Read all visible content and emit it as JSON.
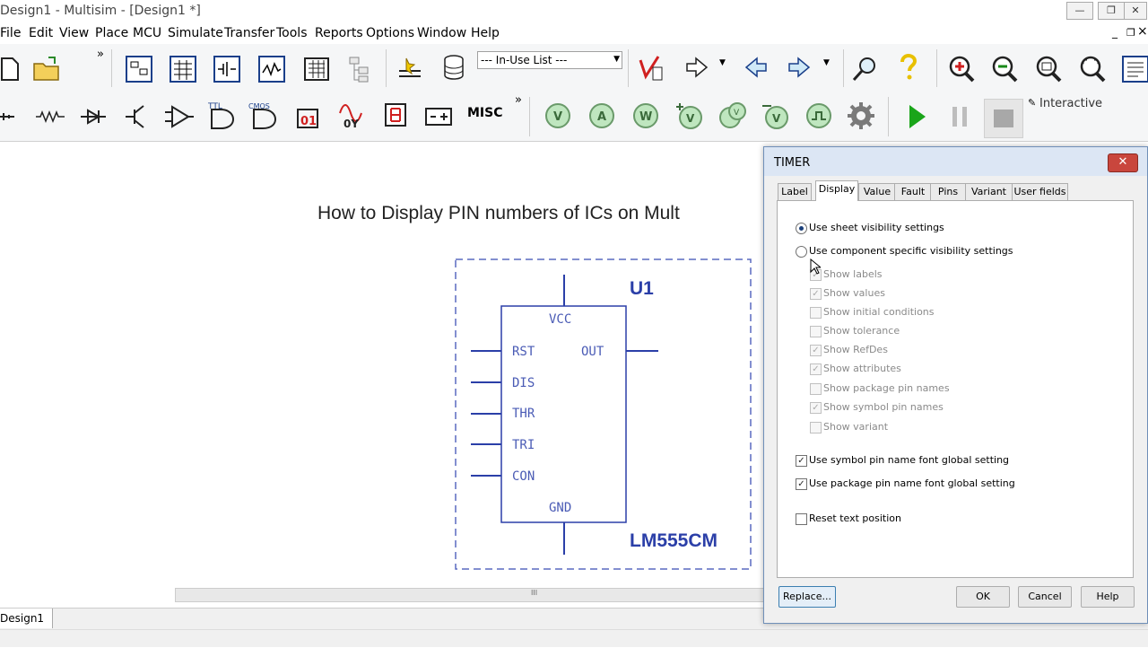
{
  "window": {
    "title": "Design1 - Multisim - [Design1 *]",
    "min_glyph": "—",
    "restore_glyph": "❐",
    "close_glyph": "✕",
    "mdi_min": "_",
    "mdi_restore": "❐",
    "mdi_close": "×"
  },
  "menu": [
    "File",
    "Edit",
    "View",
    "Place",
    "MCU",
    "Simulate",
    "Transfer",
    "Tools",
    "Reports",
    "Options",
    "Window",
    "Help"
  ],
  "toolbar": {
    "inuse_list": "--- In-Use List ---",
    "interactive_label": "Interactive",
    "misc_label": "MISC",
    "ttl_label": "TTL",
    "cmos_label": "CMOS",
    "overflow_glyph": "»",
    "meter_v": "V",
    "meter_a": "A",
    "meter_w": "W"
  },
  "schematic": {
    "heading": "How to Display PIN numbers of ICs on Mult",
    "ref": "U1",
    "part": "LM555CM",
    "pins": {
      "top": "VCC",
      "bottom": "GND",
      "left": [
        "RST",
        "DIS",
        "THR",
        "TRI",
        "CON"
      ],
      "right": "OUT"
    }
  },
  "bottom": {
    "sheet_tab": "Design1 *",
    "scroll_grip": "III"
  },
  "dialog": {
    "title": "TIMER",
    "close_glyph": "✕",
    "tabs": [
      "Label",
      "Display",
      "Value",
      "Fault",
      "Pins",
      "Variant",
      "User fields"
    ],
    "active_tab": "Display",
    "radio_options": [
      {
        "label": "Use sheet visibility settings",
        "selected": true
      },
      {
        "label": "Use component specific visibility settings",
        "selected": false
      }
    ],
    "visibility_options": [
      {
        "label": "Show labels",
        "checked": true
      },
      {
        "label": "Show values",
        "checked": true
      },
      {
        "label": "Show initial conditions",
        "checked": false
      },
      {
        "label": "Show tolerance",
        "checked": false
      },
      {
        "label": "Show RefDes",
        "checked": true
      },
      {
        "label": "Show attributes",
        "checked": true
      },
      {
        "label": "Show package pin names",
        "checked": false
      },
      {
        "label": "Show symbol pin names",
        "checked": true
      },
      {
        "label": "Show variant",
        "checked": false
      }
    ],
    "font_options": [
      {
        "label": "Use symbol pin name font global setting",
        "checked": true
      },
      {
        "label": "Use package pin name font global setting",
        "checked": true
      }
    ],
    "reset_option": {
      "label": "Reset text position",
      "checked": false
    },
    "buttons": {
      "replace": "Replace...",
      "ok": "OK",
      "cancel": "Cancel",
      "help": "Help"
    }
  },
  "colors": {
    "schematic_blue": "#2b3fa8",
    "pin_text": "#4a5bb5",
    "dialog_close_red": "#c9463d",
    "sim_run_green": "#1aa51a"
  }
}
